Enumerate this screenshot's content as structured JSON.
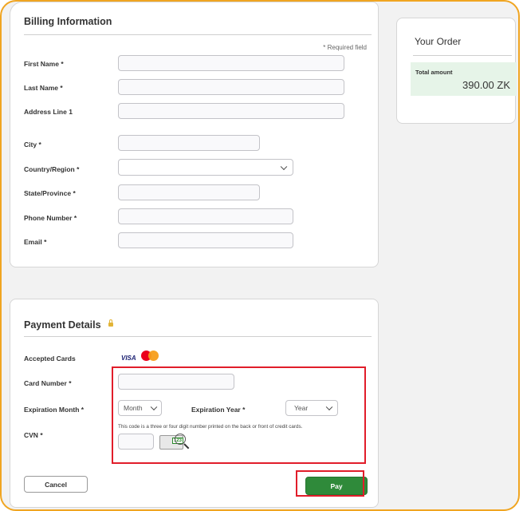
{
  "billing": {
    "title": "Billing Information",
    "required_note": "* Required field",
    "fields": {
      "first_name": {
        "label": "First Name",
        "required": "*",
        "value": ""
      },
      "last_name": {
        "label": "Last Name",
        "required": "*",
        "value": ""
      },
      "address1": {
        "label": "Address Line 1",
        "value": ""
      },
      "city": {
        "label": "City",
        "required": "*",
        "value": ""
      },
      "country": {
        "label": "Country/Region",
        "required": "*",
        "value": ""
      },
      "state": {
        "label": "State/Province",
        "required": "*",
        "value": ""
      },
      "phone": {
        "label": "Phone Number",
        "required": "*",
        "value": ""
      },
      "email": {
        "label": "Email",
        "required": "*",
        "value": ""
      }
    }
  },
  "order": {
    "title": "Your Order",
    "total_label": "Total amount",
    "total_value": "390.00 ZK"
  },
  "payment": {
    "title": "Payment Details",
    "accepted_cards_label": "Accepted Cards",
    "card_brands": [
      "VISA",
      "mastercard"
    ],
    "card_number_label": "Card Number",
    "card_number_required": "*",
    "card_number_value": "",
    "exp_month_label": "Expiration Month",
    "exp_month_required": "*",
    "exp_month_value": "Month",
    "exp_year_label": "Expiration Year",
    "exp_year_required": "*",
    "exp_year_value": "Year",
    "cvn_hint": "This code is a three or four digit number printed on the back or front of credit cards.",
    "cvn_label": "CVN",
    "cvn_required": "*",
    "cvn_value": "",
    "cvn_image_digits": "123"
  },
  "actions": {
    "cancel_label": "Cancel",
    "pay_label": "Pay"
  },
  "colors": {
    "frame_border": "#f0a521",
    "highlight": "#e11d2a",
    "pay_button": "#2f8a3a",
    "total_box": "#e6f4e8"
  }
}
